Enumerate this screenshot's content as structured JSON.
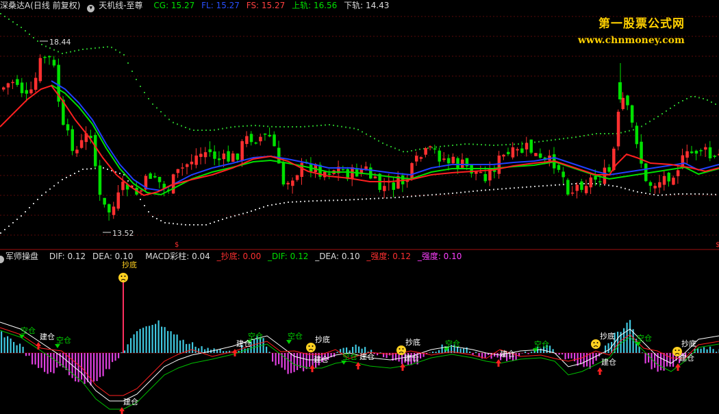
{
  "header": {
    "stock_name": "深桑达A(日线 前复权)",
    "indicator_name": "天机线-至尊",
    "cg": "CG: 15.27",
    "fl": "FL: 15.27",
    "fs": "FS: 15.27",
    "upper": "上轨: 16.56",
    "lower": "下轨: 14.43"
  },
  "watermark": {
    "line1": "第一股票公式网",
    "line2": "www.chnmoney.com"
  },
  "price_labels": {
    "high": "18.44",
    "low": "13.52"
  },
  "indicator_header": {
    "name": "军师操盘",
    "dif": "DIF: 0.12",
    "dea": "DEA: 0.10",
    "macd": "MACD彩柱: 0.04",
    "chaodi": "_抄底: 0.00",
    "dif2": "_DIF: 0.12",
    "dea2": "_DEA: 0.10",
    "qiangdu1": "_强度: 0.12",
    "qiangdu2": "_强度: 0.10"
  },
  "signals": {
    "buy": "建仓",
    "empty": "空仓",
    "bottom": "抄底",
    "bottom_top": "抄底"
  },
  "colors": {
    "up": "#ff3030",
    "down": "#00e000",
    "ma_red": "#ff2020",
    "ma_green": "#00e000",
    "ma_blue": "#2040ff",
    "band_green": "#28b828",
    "band_gray": "#c8c8c8",
    "bar_pos": "#40c8e0",
    "bar_neg": "#e040e0"
  }
}
